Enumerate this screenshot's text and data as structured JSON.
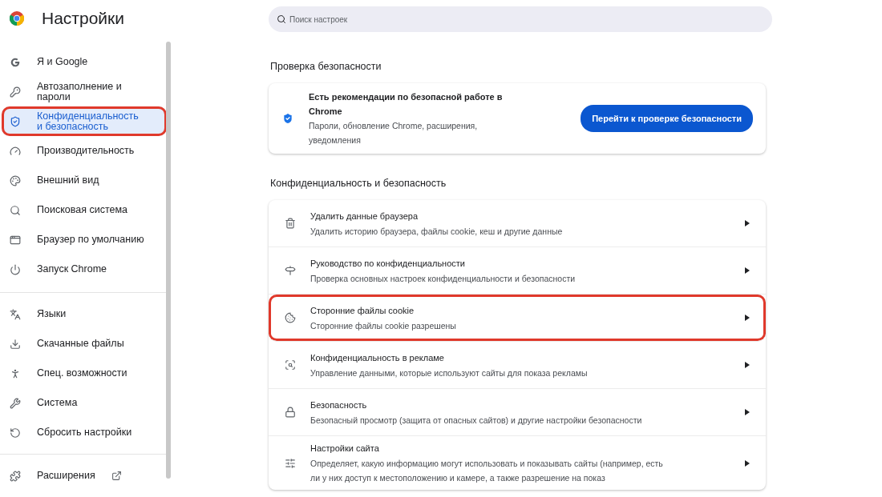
{
  "header": {
    "title": "Настройки"
  },
  "sidebar": {
    "groups": [
      {
        "items": [
          {
            "label": "Я и Google",
            "selected": false,
            "highlighted": false
          },
          {
            "label": "Автозаполнение и пароли",
            "selected": false,
            "highlighted": false
          },
          {
            "label": "Конфиденциальность и безопасность",
            "selected": true,
            "highlighted": true
          },
          {
            "label": "Производительность",
            "selected": false,
            "highlighted": false
          },
          {
            "label": "Внешний вид",
            "selected": false,
            "highlighted": false
          },
          {
            "label": "Поисковая система",
            "selected": false,
            "highlighted": false
          },
          {
            "label": "Браузер по умолчанию",
            "selected": false,
            "highlighted": false
          },
          {
            "label": "Запуск Chrome",
            "selected": false,
            "highlighted": false
          }
        ]
      },
      {
        "items": [
          {
            "label": "Языки",
            "selected": false,
            "highlighted": false
          },
          {
            "label": "Скачанные файлы",
            "selected": false,
            "highlighted": false
          },
          {
            "label": "Спец. возможности",
            "selected": false,
            "highlighted": false
          },
          {
            "label": "Система",
            "selected": false,
            "highlighted": false
          },
          {
            "label": "Сбросить настройки",
            "selected": false,
            "highlighted": false
          }
        ]
      },
      {
        "items": [
          {
            "label": "Расширения",
            "selected": false,
            "highlighted": false,
            "external": true
          }
        ]
      }
    ]
  },
  "search": {
    "placeholder": "Поиск настроек"
  },
  "safety_check": {
    "heading": "Проверка безопасности",
    "title": "Есть рекомендации по безопасной работе в Chrome",
    "subtitle": "Пароли, обновление Chrome, расширения, уведомления",
    "button": "Перейти к проверке безопасности"
  },
  "privacy": {
    "heading": "Конфиденциальность и безопасность",
    "rows": [
      {
        "title": "Удалить данные браузера",
        "subtitle": "Удалить историю браузера, файлы cookie, кеш и другие данные",
        "highlighted": false
      },
      {
        "title": "Руководство по конфиденциальности",
        "subtitle": "Проверка основных настроек конфиденциальности и безопасности",
        "highlighted": false
      },
      {
        "title": "Сторонние файлы cookie",
        "subtitle": "Сторонние файлы cookie разрешены",
        "highlighted": true
      },
      {
        "title": "Конфиденциальность в рекламе",
        "subtitle": "Управление данными, которые используют сайты для показа рекламы",
        "highlighted": false
      },
      {
        "title": "Безопасность",
        "subtitle": "Безопасный просмотр (защита от опасных сайтов) и другие настройки безопасности",
        "highlighted": false
      },
      {
        "title": "Настройки сайта",
        "subtitle": "Определяет, какую информацию могут использовать и показывать сайты (например, есть ли у них доступ к местоположению и камере, а также разрешение на показ",
        "highlighted": false
      }
    ]
  }
}
